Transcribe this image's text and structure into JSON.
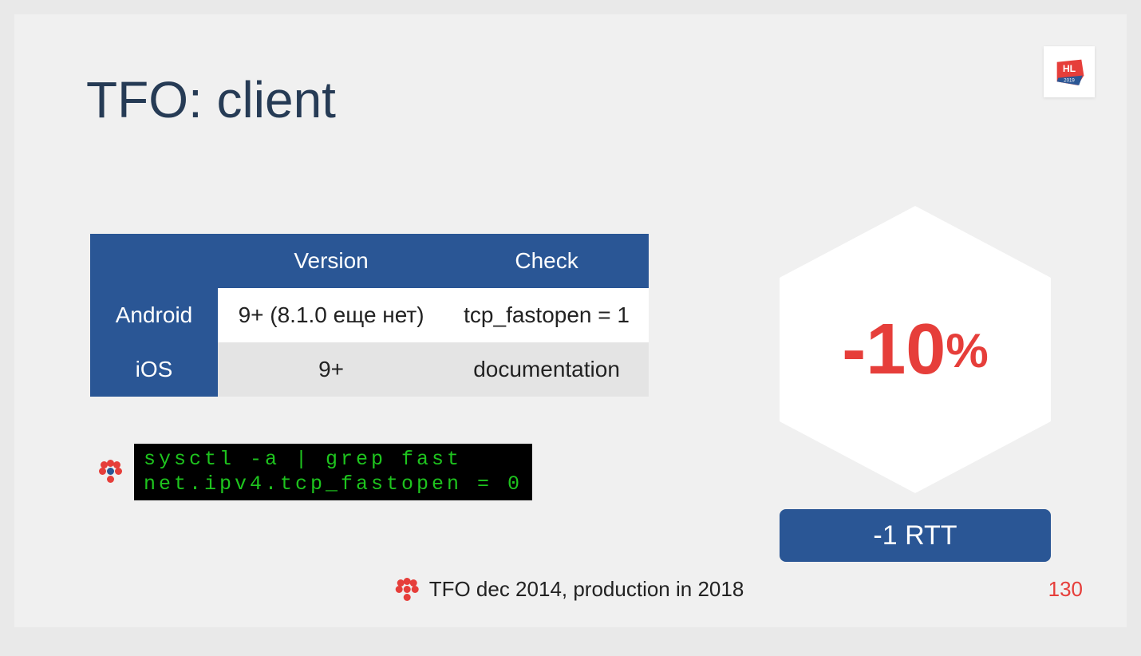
{
  "title": "TFO: client",
  "table": {
    "headers": [
      "",
      "Version",
      "Check"
    ],
    "rows": [
      {
        "label": "Android",
        "version": "9+ (8.1.0 еще нет)",
        "check": "tcp_fastopen = 1"
      },
      {
        "label": "iOS",
        "version": "9+",
        "check": "documentation"
      }
    ]
  },
  "code": "sysctl -a | grep fast\nnet.ipv4.tcp_fastopen = 0",
  "hex_value": "-10",
  "hex_pct": "%",
  "rtt": "-1 RTT",
  "footnote": "TFO dec 2014, production in 2018",
  "page": "130",
  "logo": {
    "top": "HL",
    "bottom": "2019"
  }
}
